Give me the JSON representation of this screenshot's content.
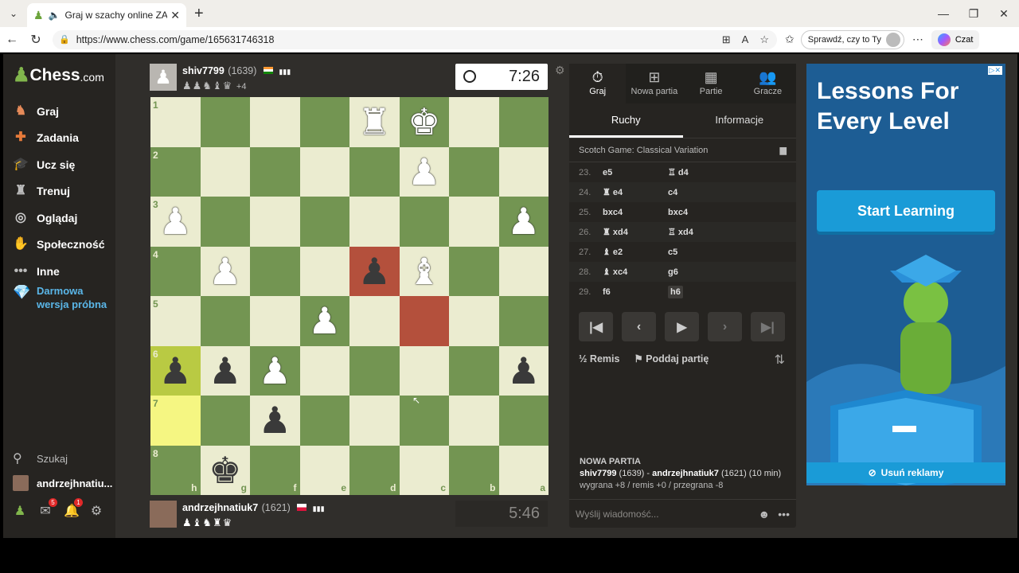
{
  "browser": {
    "tab_title": "Graj w szachy online ZA DARMO",
    "url": "https://www.chess.com/game/165631746318",
    "sprawdz_label": "Sprawdź, czy to Ty",
    "czat_label": "Czat"
  },
  "sidebar": {
    "logo_main": "Chess",
    "logo_suffix": ".com",
    "items": [
      {
        "label": "Graj",
        "icon": "play-icon"
      },
      {
        "label": "Zadania",
        "icon": "puzzle-icon"
      },
      {
        "label": "Ucz się",
        "icon": "learn-icon"
      },
      {
        "label": "Trenuj",
        "icon": "train-icon"
      },
      {
        "label": "Oglądaj",
        "icon": "watch-icon"
      },
      {
        "label": "Społeczność",
        "icon": "community-icon"
      },
      {
        "label": "Inne",
        "icon": "more-icon"
      }
    ],
    "promo": "Darmowa wersja próbna",
    "search": "Szukaj",
    "username": "andrzejhnatiu...",
    "messages_badge": "5",
    "notifications_badge": "1"
  },
  "top_player": {
    "name": "shiv7799",
    "rating": "(1639)",
    "captured": "♟♟♞♝♛",
    "advantage": "+4",
    "clock": "7:26"
  },
  "bottom_player": {
    "name": "andrzejhnatiuk7",
    "rating": "(1621)",
    "captured": "♟♝♞♜♛",
    "clock": "5:46"
  },
  "board": {
    "ranks": [
      "1",
      "2",
      "3",
      "4",
      "5",
      "6",
      "7",
      "8"
    ],
    "files": [
      "h",
      "g",
      "f",
      "e",
      "d",
      "c",
      "b",
      "a"
    ],
    "squares": [
      [
        "",
        "",
        "",
        "",
        "wR",
        "wK",
        "",
        ""
      ],
      [
        "",
        "",
        "",
        "",
        "",
        "wP",
        "",
        ""
      ],
      [
        "wP",
        "",
        "",
        "",
        "",
        "",
        "",
        "wP"
      ],
      [
        "",
        "wP",
        "",
        "",
        "bP",
        "wB",
        "",
        ""
      ],
      [
        "",
        "",
        "",
        "wP",
        "",
        "",
        "",
        ""
      ],
      [
        "bP",
        "bP",
        "wP",
        "",
        "",
        "",
        "",
        "bP"
      ],
      [
        "",
        "",
        "bP",
        "",
        "",
        "",
        "",
        ""
      ],
      [
        "",
        "bK",
        "",
        "",
        "",
        "",
        "",
        ""
      ]
    ]
  },
  "panel": {
    "tabs": [
      {
        "label": "Graj",
        "icon": "stopwatch-icon"
      },
      {
        "label": "Nowa partia",
        "icon": "plus-icon"
      },
      {
        "label": "Partie",
        "icon": "board-icon"
      },
      {
        "label": "Gracze",
        "icon": "players-icon"
      }
    ],
    "subtabs": [
      "Ruchy",
      "Informacje"
    ],
    "opening": "Scotch Game: Classical Variation",
    "moves": [
      {
        "n": "23.",
        "w": "e5",
        "b": "♖ d4"
      },
      {
        "n": "24.",
        "w": "♜ e4",
        "b": "c4"
      },
      {
        "n": "25.",
        "w": "bxc4",
        "b": "bxc4"
      },
      {
        "n": "26.",
        "w": "♜ xd4",
        "b": "♖ xd4"
      },
      {
        "n": "27.",
        "w": "♝ e2",
        "b": "c5"
      },
      {
        "n": "28.",
        "w": "♝ xc4",
        "b": "g6"
      },
      {
        "n": "29.",
        "w": "f6",
        "b": "h6"
      }
    ],
    "remis": "Remis",
    "resign": "Poddaj partię",
    "newgame_title": "NOWA PARTIA",
    "newgame_p1": "shiv7799",
    "newgame_r1": "(1639)",
    "newgame_dash": " - ",
    "newgame_p2": "andrzejhnatiuk7",
    "newgame_r2": "(1621) (10 min)",
    "newgame_stakes": "wygrana +8 / remis +0 / przegrana -8",
    "chat_placeholder": "Wyślij wiadomość..."
  },
  "ad": {
    "headline": "Lessons For Every Level",
    "button": "Start Learning",
    "remove": "Usuń reklamy"
  }
}
